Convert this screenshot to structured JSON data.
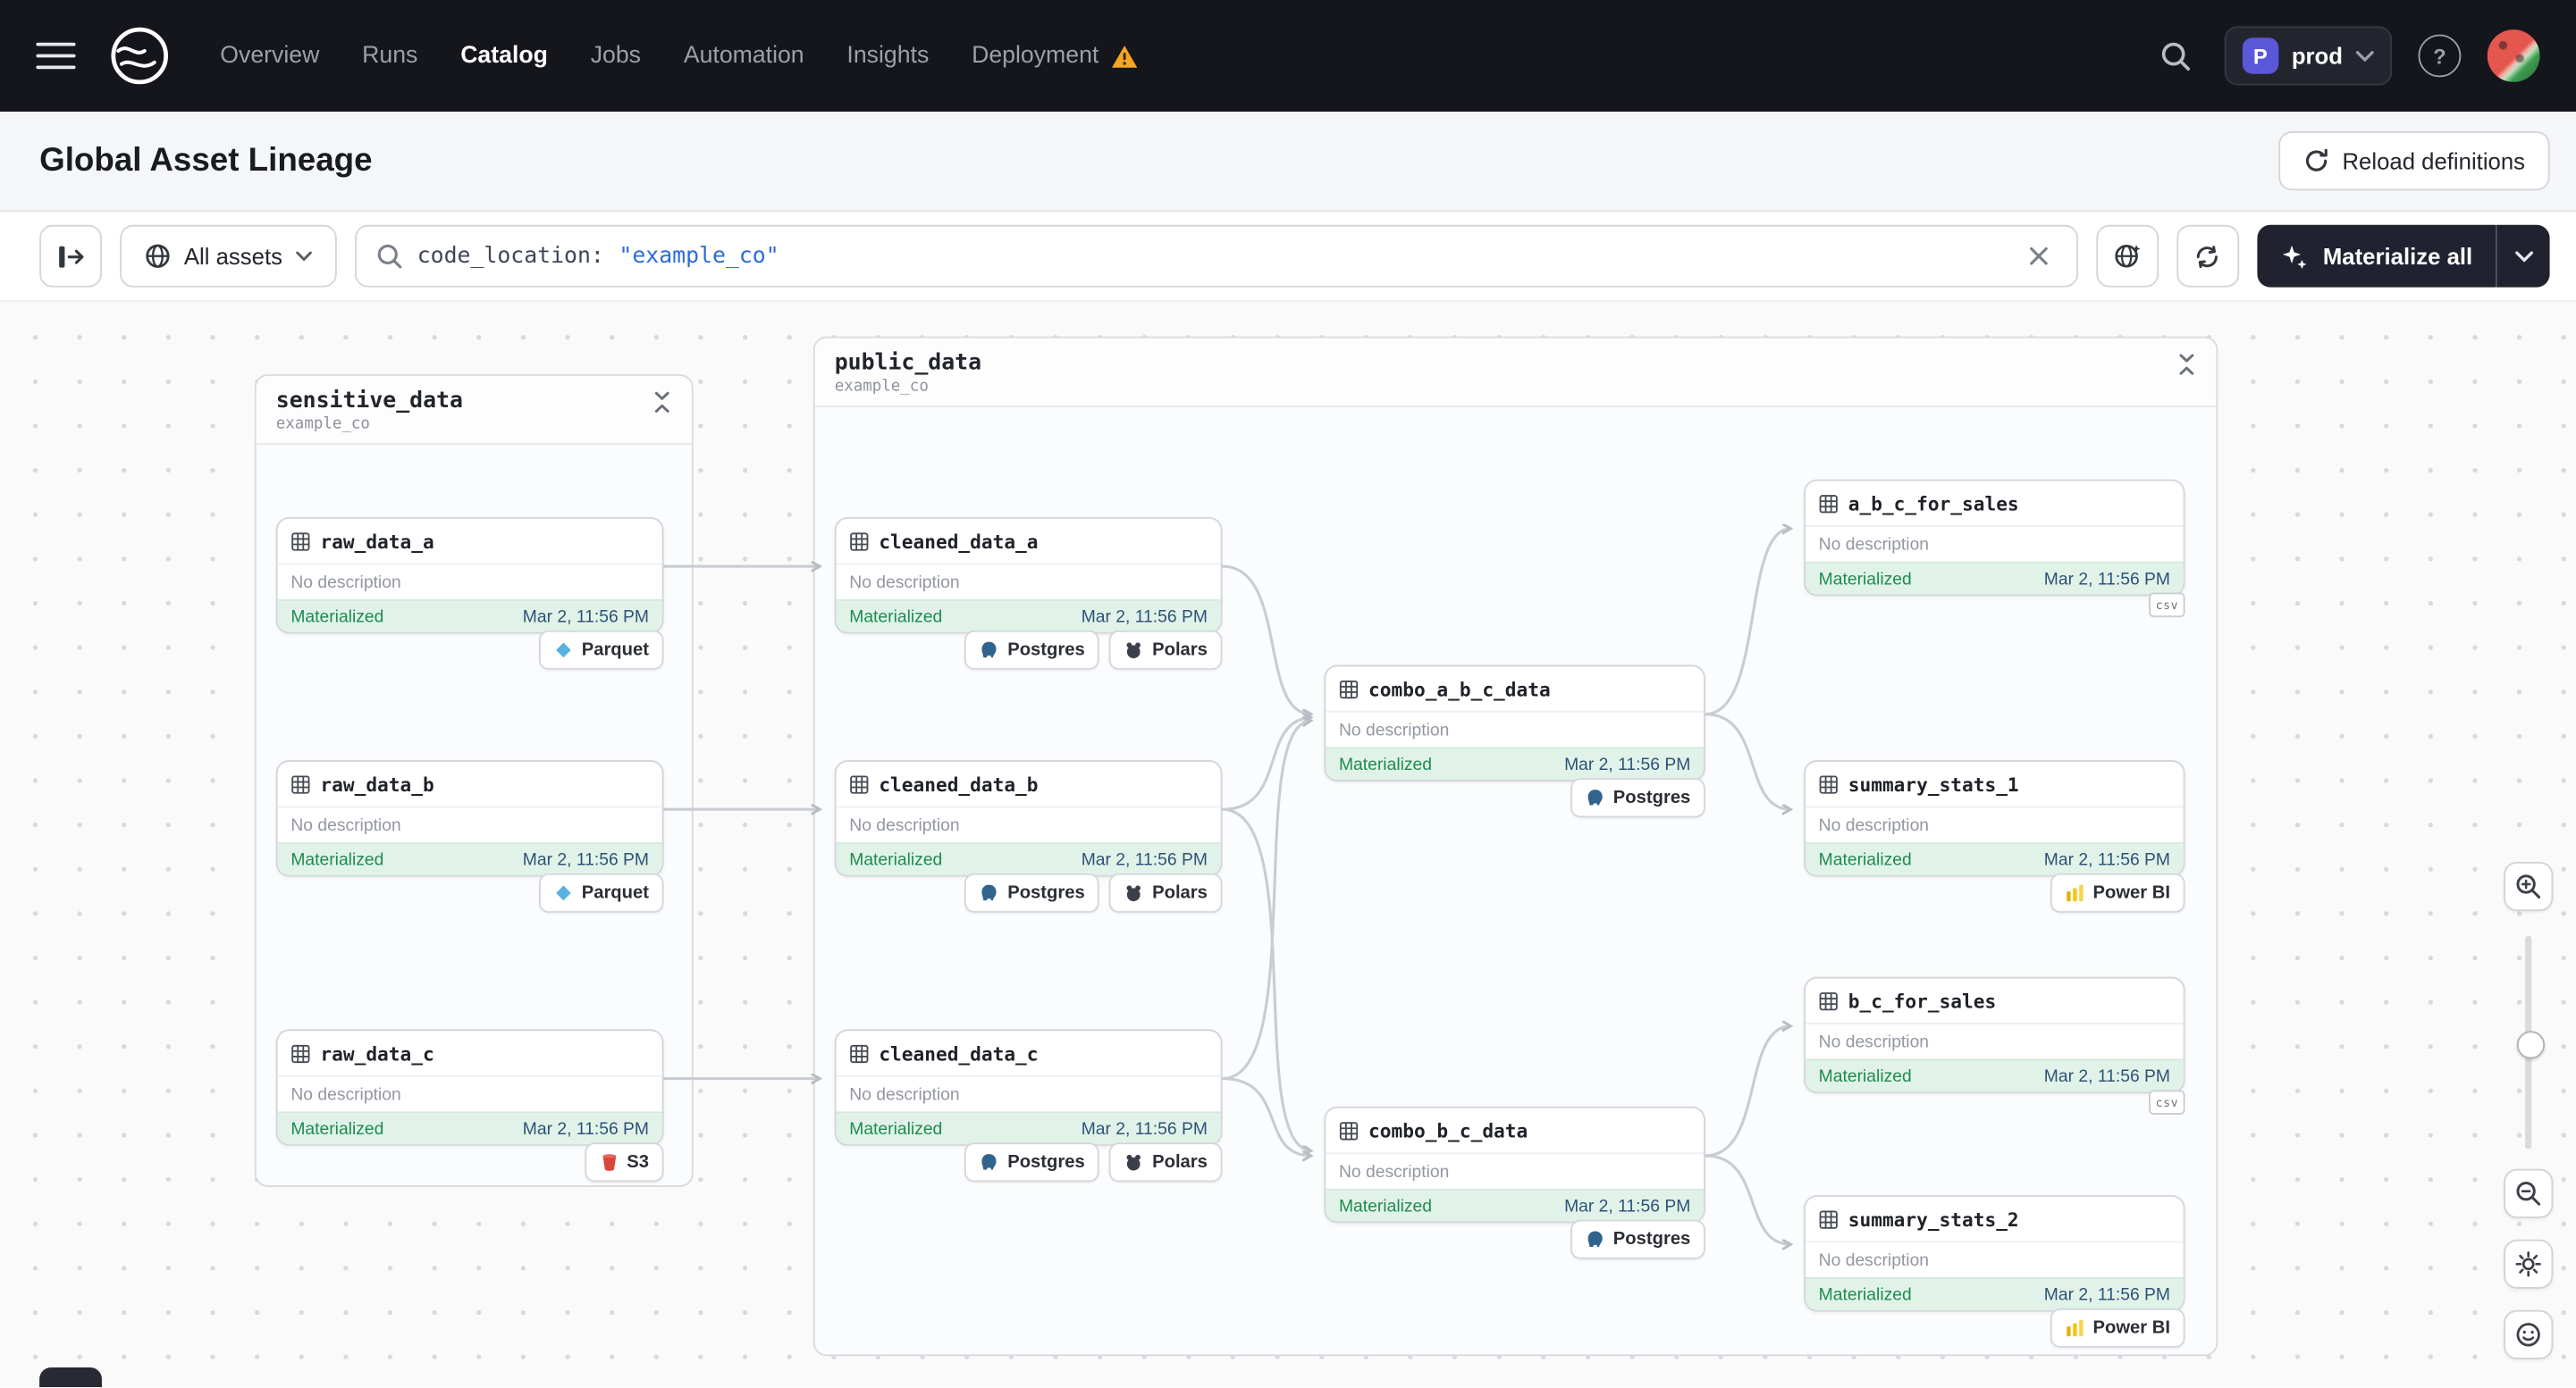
{
  "nav": {
    "items": [
      {
        "label": "Overview"
      },
      {
        "label": "Runs"
      },
      {
        "label": "Catalog"
      },
      {
        "label": "Jobs"
      },
      {
        "label": "Automation"
      },
      {
        "label": "Insights"
      },
      {
        "label": "Deployment"
      }
    ],
    "active_item": "Catalog",
    "env": {
      "letter": "P",
      "name": "prod"
    },
    "help_glyph": "?"
  },
  "header": {
    "title": "Global Asset Lineage",
    "reload_button": "Reload definitions"
  },
  "toolbar": {
    "scope_button": "All assets",
    "search": {
      "key": "code_location:",
      "value": "\"example_co\""
    },
    "materialize_button": "Materialize all"
  },
  "strings": {
    "no_description": "No description",
    "materialized": "Materialized",
    "time": "Mar 2, 11:56 PM"
  },
  "tags": {
    "parquet": "Parquet",
    "s3": "S3",
    "postgres": "Postgres",
    "polars": "Polars",
    "powerbi": "Power BI",
    "csv": "csv"
  },
  "graph": {
    "groups": [
      {
        "title": "sensitive_data",
        "subtitle": "example_co"
      },
      {
        "title": "public_data",
        "subtitle": "example_co"
      }
    ],
    "nodes": [
      {
        "name": "raw_data_a"
      },
      {
        "name": "raw_data_b"
      },
      {
        "name": "raw_data_c"
      },
      {
        "name": "cleaned_data_a"
      },
      {
        "name": "cleaned_data_b"
      },
      {
        "name": "cleaned_data_c"
      },
      {
        "name": "combo_a_b_c_data"
      },
      {
        "name": "combo_b_c_data"
      },
      {
        "name": "a_b_c_for_sales"
      },
      {
        "name": "summary_stats_1"
      },
      {
        "name": "b_c_for_sales"
      },
      {
        "name": "summary_stats_2"
      }
    ]
  }
}
